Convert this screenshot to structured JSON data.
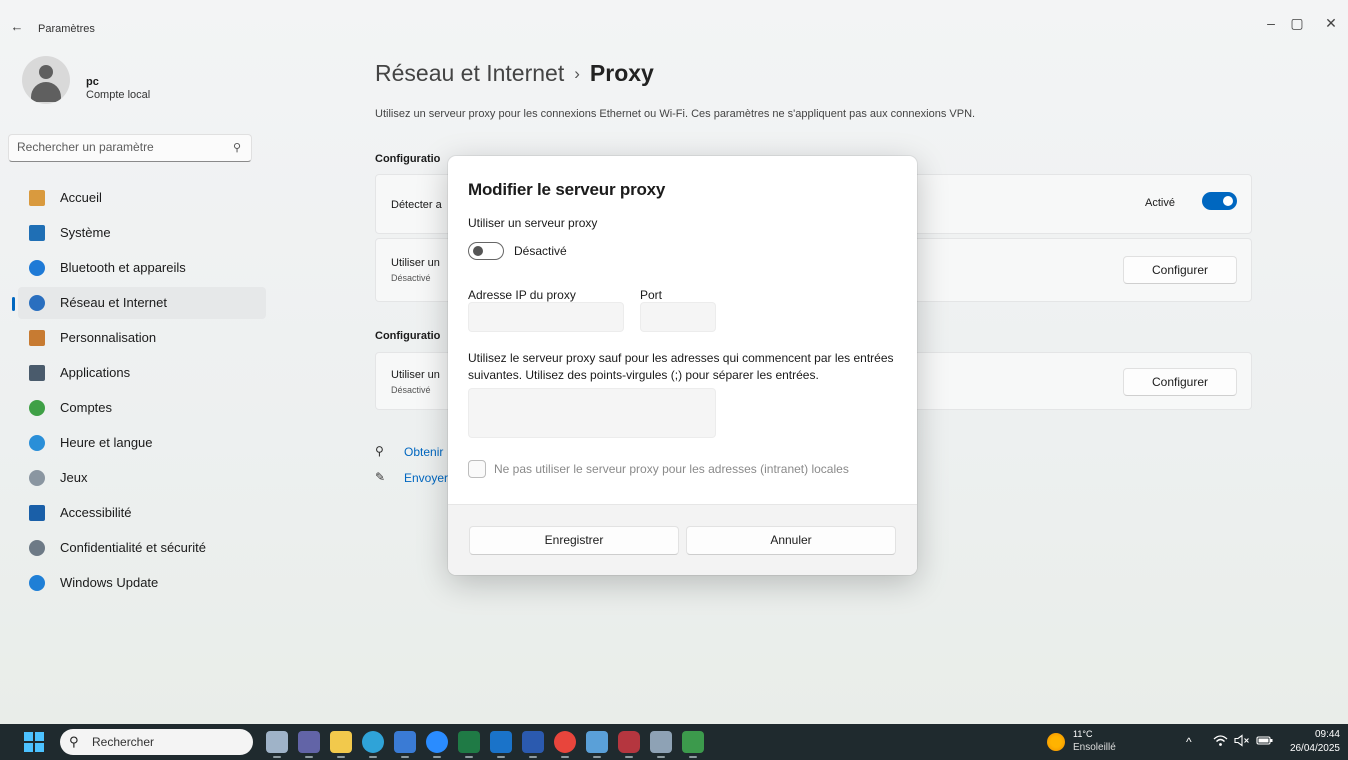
{
  "window": {
    "title": "Paramètres",
    "back": "←",
    "controls": {
      "minimize": "–",
      "maximize": "▢",
      "close": "✕"
    }
  },
  "profile": {
    "name": "pc",
    "account_type": "Compte local"
  },
  "search": {
    "placeholder": "Rechercher un paramètre",
    "icon": "search-icon"
  },
  "sidebar": {
    "items": [
      {
        "label": "Accueil",
        "icon": "home-icon",
        "color": "#d99a3e"
      },
      {
        "label": "Système",
        "icon": "system-icon",
        "color": "#1f6fb5"
      },
      {
        "label": "Bluetooth et appareils",
        "icon": "bluetooth-icon",
        "color": "#1e7ad6"
      },
      {
        "label": "Réseau et Internet",
        "icon": "wifi-icon",
        "color": "#2a6fbf",
        "active": true
      },
      {
        "label": "Personnalisation",
        "icon": "brush-icon",
        "color": "#c77b32"
      },
      {
        "label": "Applications",
        "icon": "apps-icon",
        "color": "#4a5b6c"
      },
      {
        "label": "Comptes",
        "icon": "accounts-icon",
        "color": "#3fa046"
      },
      {
        "label": "Heure et langue",
        "icon": "time-language-icon",
        "color": "#2a8fd8"
      },
      {
        "label": "Jeux",
        "icon": "gaming-icon",
        "color": "#8a96a1"
      },
      {
        "label": "Accessibilité",
        "icon": "accessibility-icon",
        "color": "#1a5fa8"
      },
      {
        "label": "Confidentialité et sécurité",
        "icon": "shield-icon",
        "color": "#6d7a86"
      },
      {
        "label": "Windows Update",
        "icon": "update-icon",
        "color": "#1f7fd6"
      }
    ]
  },
  "main": {
    "breadcrumb": {
      "parent": "Réseau et Internet",
      "separator": "›",
      "current": "Proxy"
    },
    "description": "Utilisez un serveur proxy pour les connexions Ethernet ou Wi-Fi. Ces paramètres ne s'appliquent pas aux connexions VPN.",
    "section_auto": "Configuratio",
    "auto_detect": {
      "label": "Détecter a",
      "toggle_label": "Activé"
    },
    "auto_script": {
      "label": "Utiliser un",
      "status": "Désactivé",
      "button": "Configurer"
    },
    "section_manual": "Configuratio",
    "manual": {
      "label": "Utiliser un",
      "status": "Désactivé",
      "button": "Configurer"
    },
    "help_links": [
      {
        "text": "Obtenir",
        "icon": "help-icon"
      },
      {
        "text": "Envoyer",
        "icon": "feedback-icon"
      }
    ]
  },
  "dialog": {
    "title": "Modifier le serveur proxy",
    "use_proxy_label": "Utiliser un serveur proxy",
    "use_proxy_state": "Désactivé",
    "ip_label": "Adresse IP du proxy",
    "port_label": "Port",
    "ip_value": "",
    "port_value": "",
    "exceptions_text": "Utilisez le serveur proxy sauf pour les adresses qui commencent par les entrées suivantes. Utilisez des points-virgules (;) pour séparer les entrées.",
    "exceptions_value": "",
    "local_checkbox_label": "Ne pas utiliser le serveur proxy pour les adresses (intranet) locales",
    "save_button": "Enregistrer",
    "cancel_button": "Annuler"
  },
  "taskbar": {
    "search_label": "Rechercher",
    "apps": [
      {
        "name": "task-view-icon",
        "color": "#9fb3c8"
      },
      {
        "name": "teams-icon",
        "color": "#6264a7"
      },
      {
        "name": "file-explorer-icon",
        "color": "#f2c94c"
      },
      {
        "name": "edge-icon",
        "color": "#2fa3d8"
      },
      {
        "name": "app-blue-icon",
        "color": "#3a7bd5"
      },
      {
        "name": "help-app-icon",
        "color": "#2a8cff"
      },
      {
        "name": "excel-icon",
        "color": "#1f7a45"
      },
      {
        "name": "outlook-icon",
        "color": "#1a73c9"
      },
      {
        "name": "word-icon",
        "color": "#2b5aaf"
      },
      {
        "name": "chrome-icon",
        "color": "#e8453c"
      },
      {
        "name": "photos-icon",
        "color": "#5aa0d8"
      },
      {
        "name": "d-app-icon",
        "color": "#b5363f"
      },
      {
        "name": "settings-app-icon",
        "color": "#8ea2b5"
      },
      {
        "name": "network-app-icon",
        "color": "#3c9a4c"
      }
    ],
    "weather": {
      "temp": "11°C",
      "condition": "Ensoleillé"
    },
    "tray": {
      "chevron": "^",
      "wifi": "wifi-icon",
      "volume": "volume-muted-icon",
      "battery": "battery-icon"
    },
    "clock": {
      "time": "09:44",
      "date": "26/04/2025"
    }
  }
}
